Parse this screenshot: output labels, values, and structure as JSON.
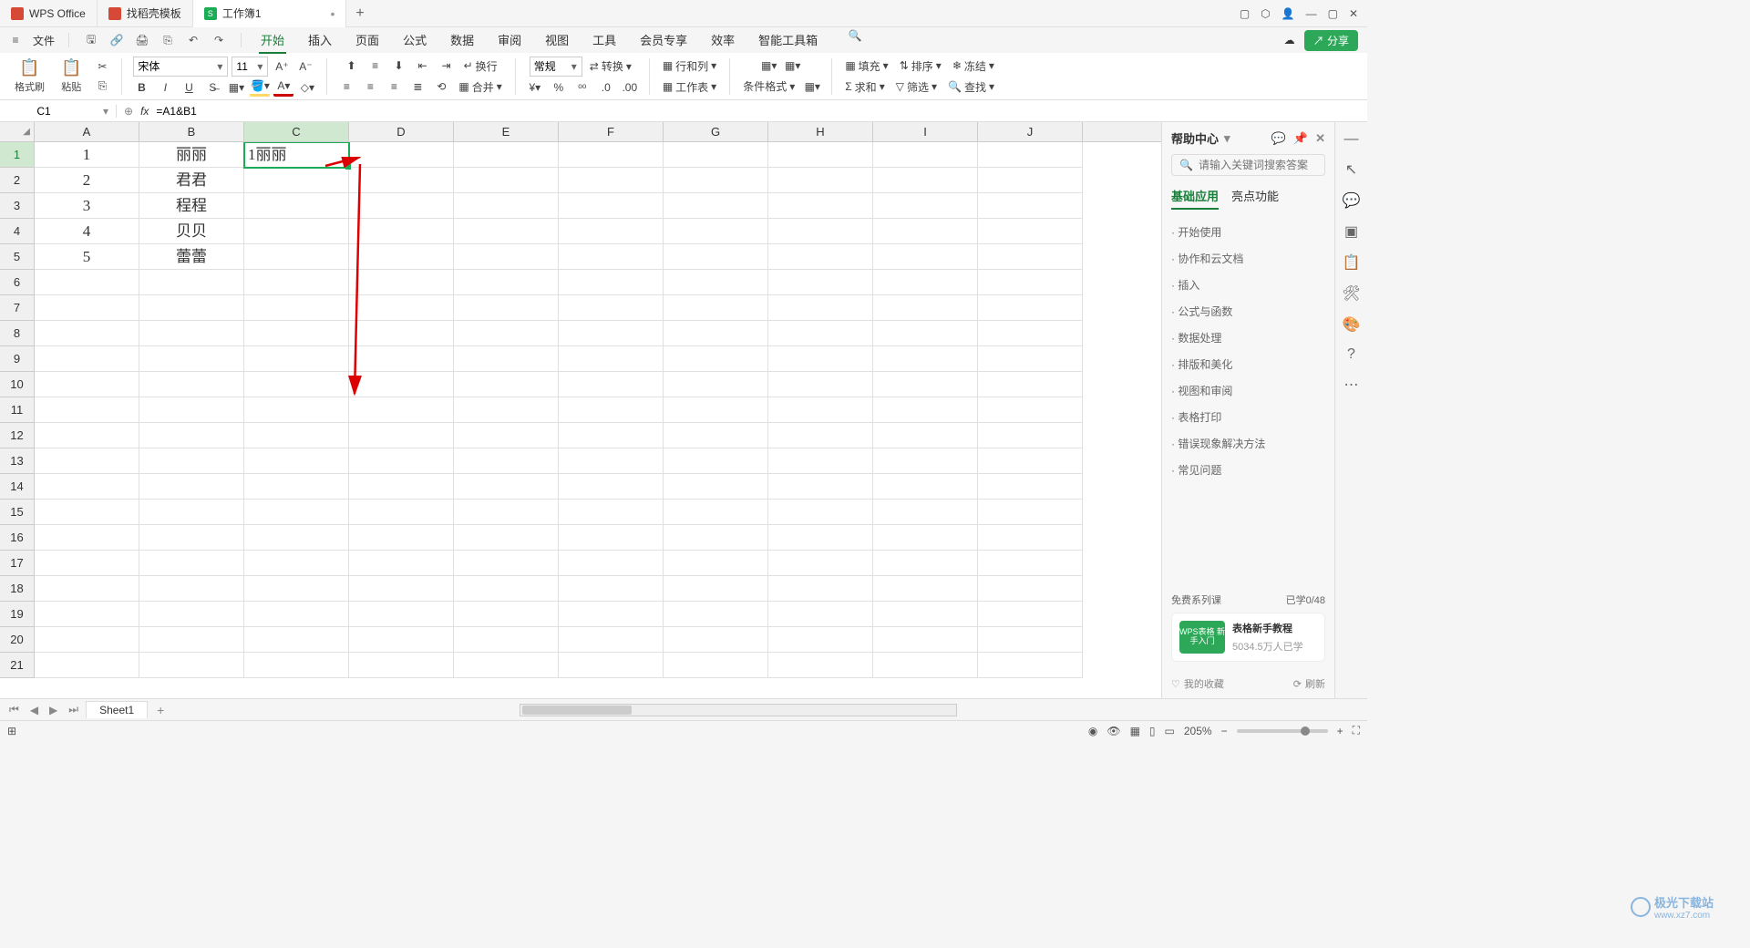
{
  "tabs": [
    {
      "label": "WPS Office"
    },
    {
      "label": "找稻壳模板"
    },
    {
      "label": "工作簿1",
      "active": true
    }
  ],
  "menu": {
    "file": "文件",
    "items": [
      "开始",
      "插入",
      "页面",
      "公式",
      "数据",
      "审阅",
      "视图",
      "工具",
      "会员专享",
      "效率",
      "智能工具箱"
    ],
    "active": "开始",
    "share": "分享"
  },
  "ribbon": {
    "format_brush": "格式刷",
    "paste": "粘贴",
    "font_name": "宋体",
    "font_size": "11",
    "wrap": "换行",
    "merge": "合并",
    "general": "常规",
    "convert": "转换",
    "rowcol": "行和列",
    "worksheet": "工作表",
    "cond_format": "条件格式",
    "fill": "填充",
    "sort": "排序",
    "freeze": "冻结",
    "sum": "求和",
    "filter": "筛选",
    "find": "查找"
  },
  "formula_bar": {
    "cell_ref": "C1",
    "formula": "=A1&B1"
  },
  "columns": [
    "A",
    "B",
    "C",
    "D",
    "E",
    "F",
    "G",
    "H",
    "I",
    "J"
  ],
  "row_count": 21,
  "cells": {
    "A1": "1",
    "B1": "丽丽",
    "C1": "1丽丽",
    "A2": "2",
    "B2": "君君",
    "A3": "3",
    "B3": "程程",
    "A4": "4",
    "B4": "贝贝",
    "A5": "5",
    "B5": "蕾蕾"
  },
  "selected_cell": "C1",
  "help": {
    "title": "帮助中心",
    "search_placeholder": "请输入关键词搜索答案",
    "tabs": [
      "基础应用",
      "亮点功能"
    ],
    "active_tab": "基础应用",
    "items": [
      "开始使用",
      "协作和云文档",
      "插入",
      "公式与函数",
      "数据处理",
      "排版和美化",
      "视图和审阅",
      "表格打印",
      "错误现象解决方法",
      "常见问题"
    ],
    "course_head": "免费系列课",
    "course_progress": "已学0/48",
    "course_thumb": "WPS表格\n新手入门",
    "course_title": "表格新手教程",
    "course_sub": "5034.5万人已学",
    "fav": "我的收藏",
    "refresh": "刷新"
  },
  "sheets": {
    "active": "Sheet1"
  },
  "status": {
    "zoom": "205%"
  },
  "watermark": {
    "text": "极光下载站",
    "url": "www.xz7.com"
  }
}
